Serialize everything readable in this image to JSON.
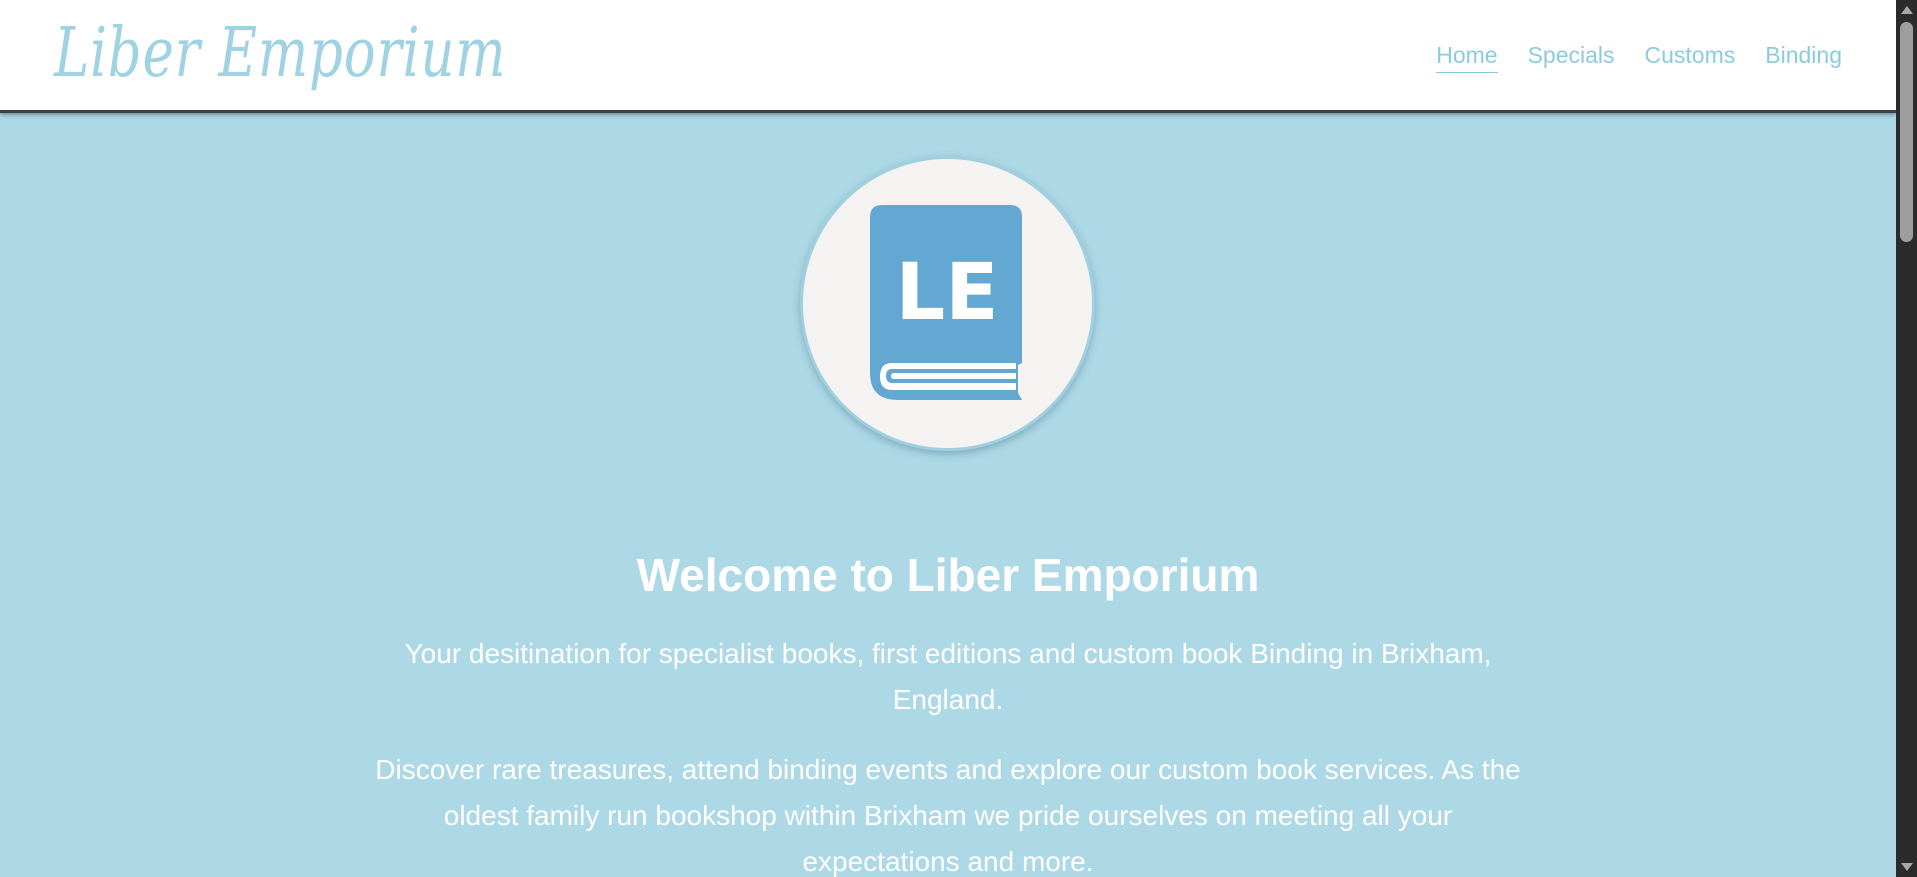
{
  "header": {
    "brand": "Liber Emporium",
    "nav": [
      {
        "label": "Home",
        "active": true
      },
      {
        "label": "Specials",
        "active": false
      },
      {
        "label": "Customs",
        "active": false
      },
      {
        "label": "Binding",
        "active": false
      }
    ]
  },
  "hero": {
    "logo_initials": "LE",
    "logo_icon": "book-icon",
    "title": "Welcome to Liber Emporium",
    "paragraph_1": "Your desitination for specialist books, first editions and custom book Binding in Brixham, England.",
    "paragraph_2": "Discover rare treasures, attend binding events and explore our custom book services. As the oldest family run bookshop within Brixham we pride ourselves on meeting all your expectations and more."
  },
  "colors": {
    "page_background": "#add8e6",
    "header_background": "#ffffff",
    "accent": "#8ccbdf",
    "book_blue": "#62a8d3",
    "logo_circle": "#f5f3f1"
  }
}
